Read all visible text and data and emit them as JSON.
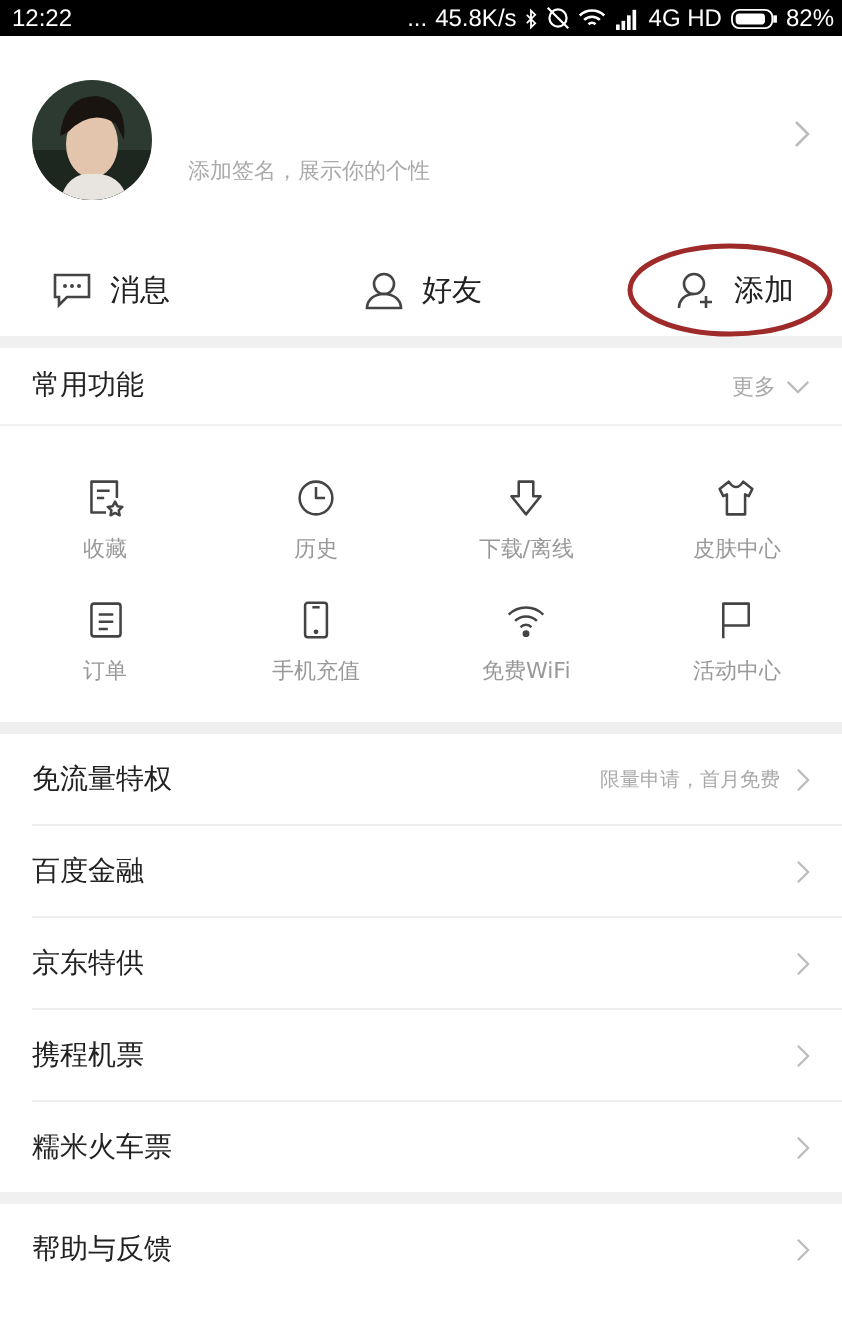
{
  "status_bar": {
    "time": "12:22",
    "dots": "...",
    "speed": "45.8K/s",
    "network": "4G HD",
    "battery": "82%"
  },
  "profile": {
    "signature_placeholder": "添加签名，展示你的个性"
  },
  "actions": [
    {
      "label": "消息",
      "highlighted": false
    },
    {
      "label": "好友",
      "highlighted": false
    },
    {
      "label": "添加",
      "highlighted": true
    }
  ],
  "functions": {
    "title": "常用功能",
    "more": "更多",
    "items": [
      {
        "label": "收藏"
      },
      {
        "label": "历史"
      },
      {
        "label": "下载/离线"
      },
      {
        "label": "皮肤中心"
      },
      {
        "label": "订单"
      },
      {
        "label": "手机充值"
      },
      {
        "label": "免费WiFi"
      },
      {
        "label": "活动中心"
      }
    ]
  },
  "list": [
    {
      "label": "免流量特权",
      "note": "限量申请，首月免费"
    },
    {
      "label": "百度金融"
    },
    {
      "label": "京东特供"
    },
    {
      "label": "携程机票"
    },
    {
      "label": "糯米火车票"
    }
  ],
  "list_2": [
    {
      "label": "帮助与反馈"
    }
  ]
}
